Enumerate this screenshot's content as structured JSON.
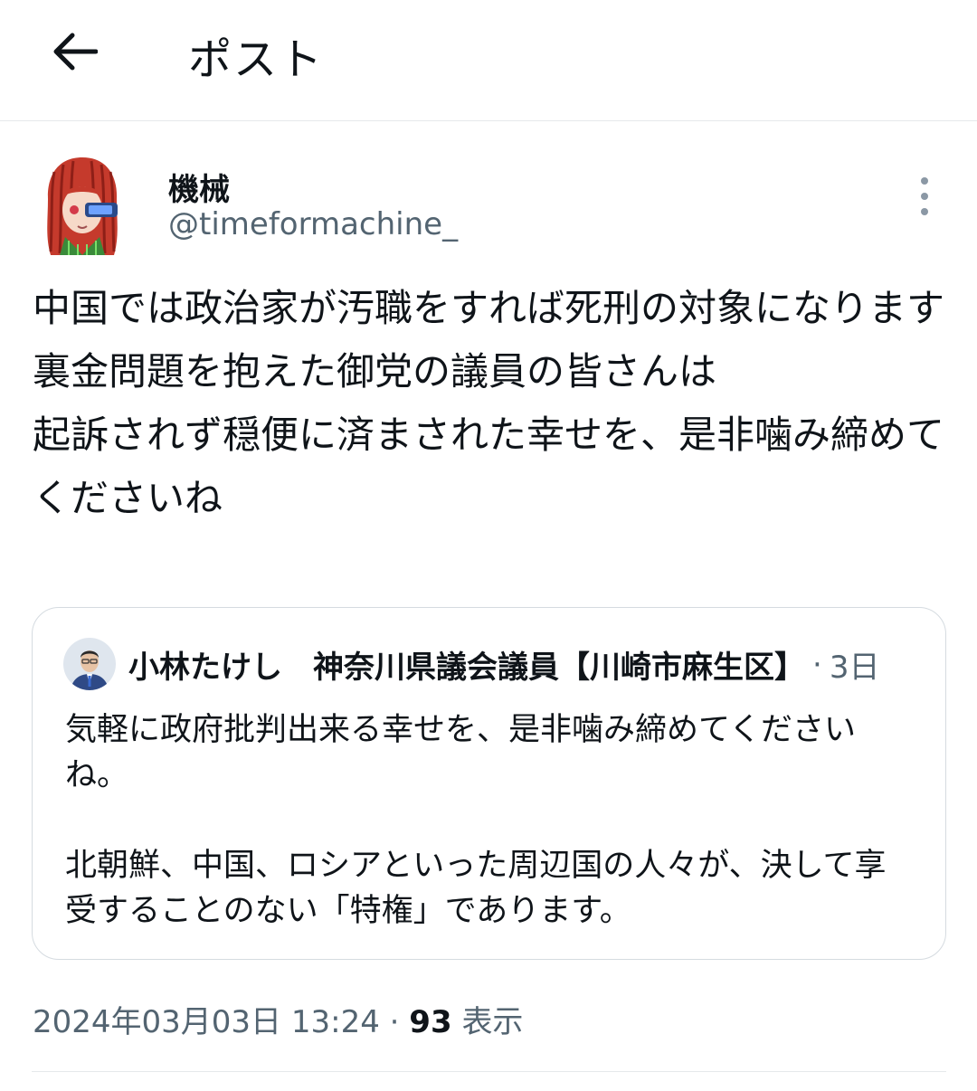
{
  "header": {
    "title": "ポスト",
    "back_icon": "arrow-left-icon"
  },
  "tweet": {
    "author": {
      "display_name": "機械",
      "handle": "@timeformachine_",
      "avatar": "user-avatar"
    },
    "more_icon": "more-vertical-icon",
    "text": "中国では政治家が汚職をすれば死刑の対象になります\n裏金問題を抱えた御党の議員の皆さんは\n起訴されず穏便に済まされた幸せを、是非噛み締めてくださいね",
    "timestamp": "2024年03月03日 13:24",
    "separator": "·",
    "views_count": "93",
    "views_label": "表示"
  },
  "quote": {
    "author_name": "小林たけし　神奈川県議会議員【川崎市麻生区】",
    "separator": "·",
    "time": "3日",
    "text": "気軽に政府批判出来る幸せを、是非噛み締めてくださいね。\n\n北朝鮮、中国、ロシアといった周辺国の人々が、決して享受することのない「特権」であります。"
  },
  "colors": {
    "text_primary": "#0f1419",
    "text_secondary": "#536471",
    "border": "#d5dbe0",
    "divider": "#e6e9eb"
  }
}
